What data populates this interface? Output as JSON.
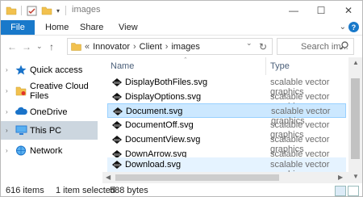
{
  "window": {
    "title": "images"
  },
  "quick_access": {
    "undo_icon": "checkmark-properties-icon",
    "folder_icon": "folder-icon",
    "dropdown_icon": "chevron-down-icon"
  },
  "controls": {
    "minimize": "—",
    "maximize": "☐",
    "close": "✕"
  },
  "ribbon": {
    "tabs": [
      {
        "label": "File"
      },
      {
        "label": "Home"
      },
      {
        "label": "Share"
      },
      {
        "label": "View"
      }
    ],
    "expand_glyph": "⌄",
    "help_glyph": "?"
  },
  "address": {
    "back_glyph": "←",
    "forward_glyph": "→",
    "recent_glyph": "⌄",
    "up_glyph": "↑",
    "overflow": "«",
    "breadcrumb": [
      "Innovator",
      "Client",
      "images"
    ],
    "separator": "›",
    "dropdown_glyph": "⌄",
    "refresh_glyph": "↻"
  },
  "search": {
    "placeholder": "Search im...",
    "icon_glyph": "⚲"
  },
  "nav": {
    "items": [
      {
        "label": "Quick access",
        "icon": "star-icon",
        "color": "#1a73c9"
      },
      {
        "label": "Creative Cloud Files",
        "icon": "folder-icon",
        "color": "#f2c14e"
      },
      {
        "label": "OneDrive",
        "icon": "cloud-icon",
        "color": "#1a73c9"
      },
      {
        "label": "This PC",
        "icon": "computer-icon",
        "color": "#2a7ed6",
        "selected": true
      },
      {
        "label": "Network",
        "icon": "network-icon",
        "color": "#1a73c9"
      }
    ]
  },
  "columns": {
    "name": "Name",
    "type": "Type"
  },
  "files": [
    {
      "name": "DisplayBothFiles.svg",
      "type": "scalable vector graphics"
    },
    {
      "name": "DisplayOptions.svg",
      "type": "scalable vector graphics"
    },
    {
      "name": "Document.svg",
      "type": "scalable vector graphics",
      "selected": true
    },
    {
      "name": "DocumentOff.svg",
      "type": "scalable vector graphics"
    },
    {
      "name": "DocumentView.svg",
      "type": "scalable vector graphics"
    },
    {
      "name": "DownArrow.svg",
      "type": "scalable vector graphics"
    },
    {
      "name": "Download.svg",
      "type": "scalable vector graphics",
      "hover": true
    }
  ],
  "status": {
    "count": "616 items",
    "selected": "1 item selected",
    "size": "588 bytes"
  },
  "colors": {
    "accent": "#1979ca",
    "selection": "#cce8ff",
    "selection_border": "#99d1ff",
    "nav_selection": "#ccd6df",
    "header_text": "#4c607a"
  }
}
